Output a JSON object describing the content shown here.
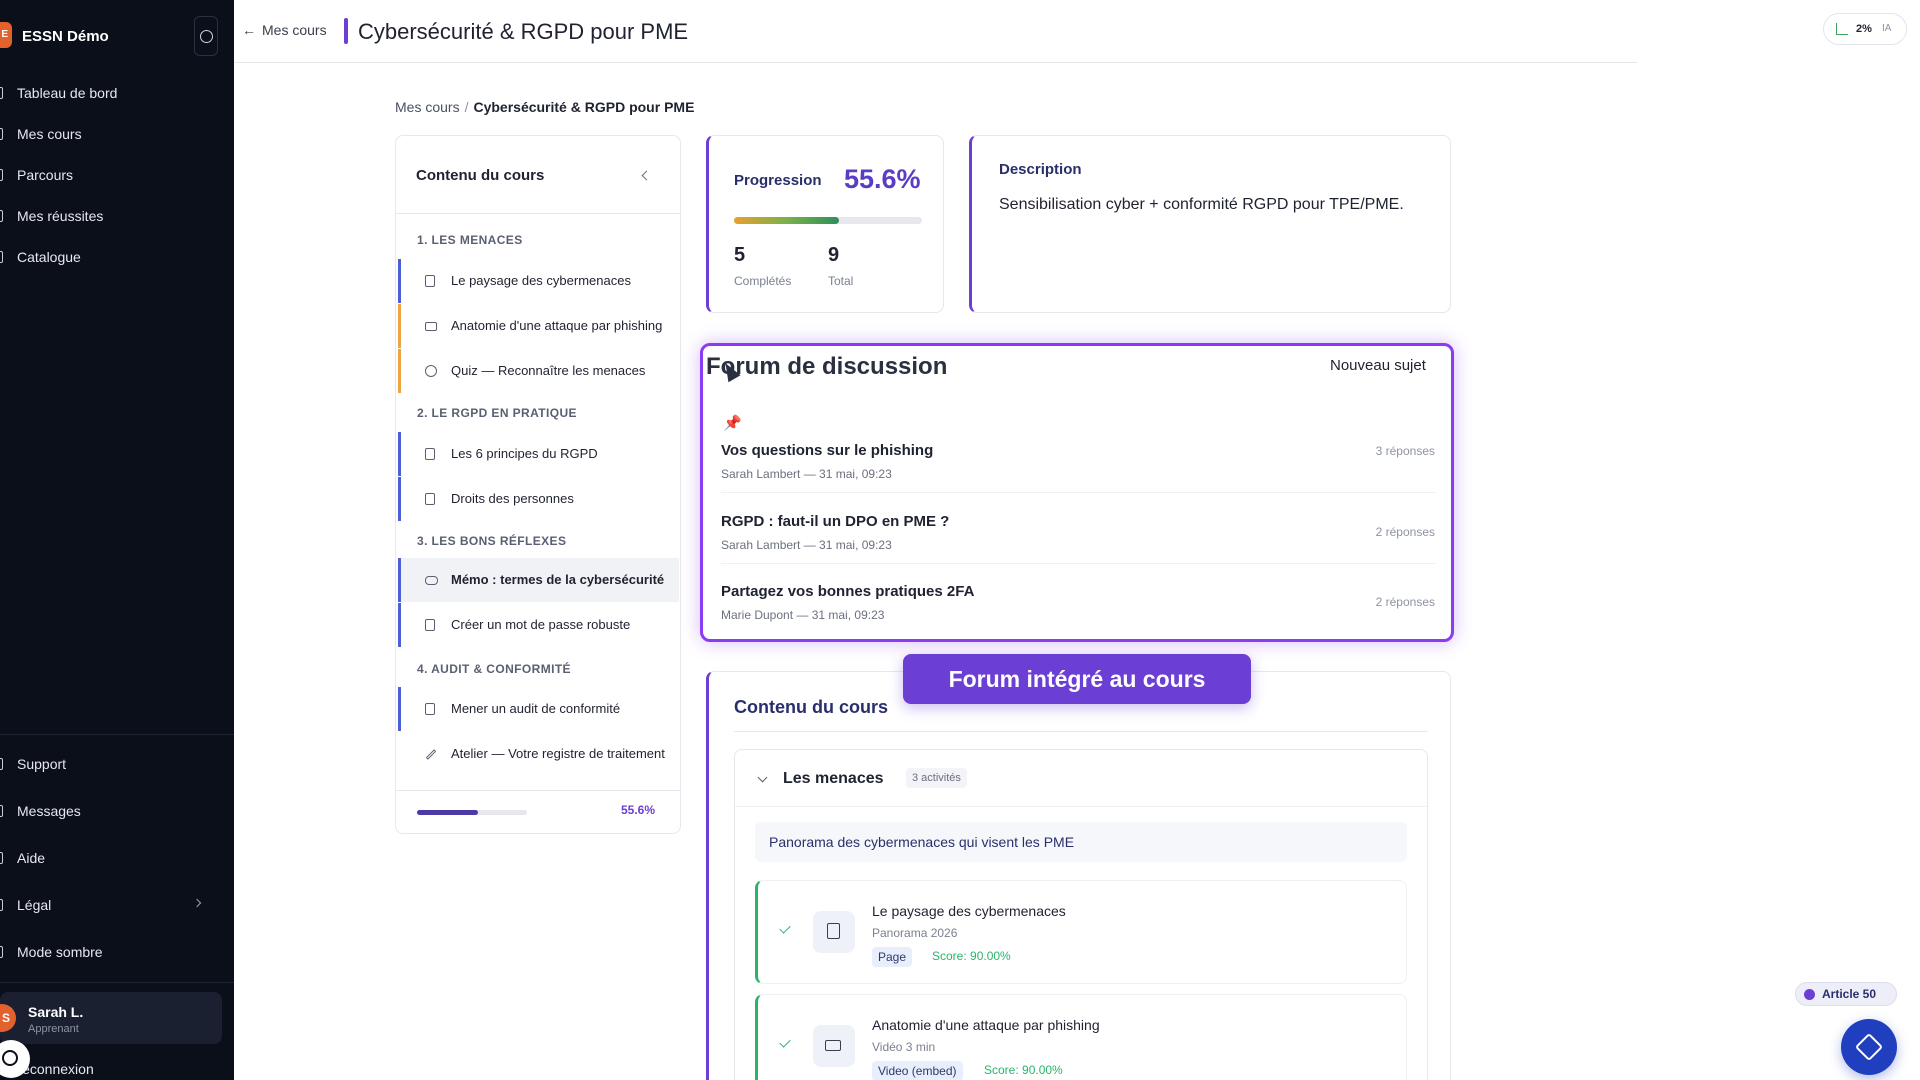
{
  "sidebar": {
    "brand_initial": "E",
    "brand_name": "ESSN Démo",
    "nav": [
      "Tableau de bord",
      "Mes cours",
      "Parcours",
      "Mes réussites",
      "Catalogue"
    ],
    "bottom_nav": [
      "Support",
      "Messages",
      "Aide",
      "Légal",
      "Mode sombre"
    ],
    "user_initial": "S",
    "user_name": "Sarah L.",
    "user_role": "Apprenant",
    "logout": "Déconnexion"
  },
  "topbar": {
    "back_label": "Mes cours",
    "page_title": "Cybersécurité & RGPD pour PME",
    "ai_pct": "2%",
    "ai_label": "IA"
  },
  "breadcrumb": {
    "parent": "Mes cours",
    "separator": "/",
    "current": "Cybersécurité & RGPD pour PME"
  },
  "course_panel": {
    "title": "Contenu du cours",
    "sections": [
      {
        "title": "1. LES MENACES",
        "items": [
          "Le paysage des cybermenaces",
          "Anatomie d'une attaque par phishing",
          "Quiz — Reconnaître les menaces"
        ]
      },
      {
        "title": "2. LE RGPD EN PRATIQUE",
        "items": [
          "Les 6 principes du RGPD",
          "Droits des personnes"
        ]
      },
      {
        "title": "3. LES BONS RÉFLEXES",
        "items": [
          "Mémo : termes de la cybersécurité",
          "Créer un mot de passe robuste"
        ]
      },
      {
        "title": "4. AUDIT & CONFORMITÉ",
        "items": [
          "Mener un audit de conformité",
          "Atelier — Votre registre de traitement"
        ]
      }
    ],
    "progress_pct": "55.6%",
    "progress_fraction": 0.556
  },
  "progress": {
    "title": "Progression",
    "pct": "55.6%",
    "fraction": 0.556,
    "completed": "5",
    "completed_label": "Complétés",
    "total": "9",
    "total_label": "Total"
  },
  "description": {
    "title": "Description",
    "text": "Sensibilisation cyber + conformité RGPD pour TPE/PME."
  },
  "forum": {
    "title": "Forum de discussion",
    "new_topic": "Nouveau sujet",
    "pin_icon": "📌",
    "topics": [
      {
        "title": "Vos questions sur le phishing",
        "meta": "Sarah Lambert — 31 mai, 09:23",
        "replies": "3 réponses"
      },
      {
        "title": "RGPD : faut-il un DPO en PME ?",
        "meta": "Sarah Lambert — 31 mai, 09:23",
        "replies": "2 réponses"
      },
      {
        "title": "Partagez vos bonnes pratiques 2FA",
        "meta": "Marie Dupont — 31 mai, 09:23",
        "replies": "2 réponses"
      }
    ]
  },
  "highlight_label": "Forum intégré au cours",
  "main_contents": {
    "title": "Contenu du cours",
    "module_title": "Les menaces",
    "module_badge": "3 activités",
    "module_desc": "Panorama des cybermenaces qui visent les PME",
    "activities": [
      {
        "title": "Le paysage des cybermenaces",
        "subtitle": "Panorama 2026",
        "tag": "Page",
        "score": "Score: 90.00%"
      },
      {
        "title": "Anatomie d'une attaque par phishing",
        "subtitle": "Vidéo 3 min",
        "tag": "Video (embed)",
        "score": "Score: 90.00%"
      }
    ]
  },
  "widgets": {
    "article_label": "Article 50"
  },
  "colors": {
    "accent": "#6b3fd4",
    "forum_border": "#8b3cf0",
    "sidebar_bg": "#0b0f1a",
    "success": "#2bb36a"
  }
}
